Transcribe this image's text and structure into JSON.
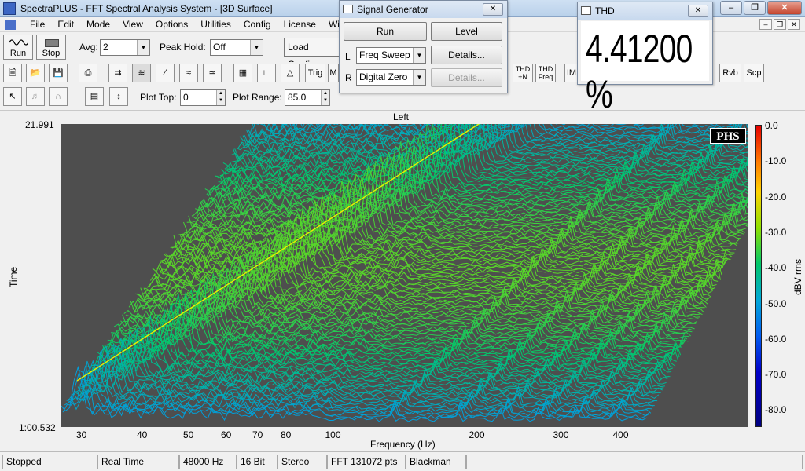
{
  "window": {
    "title": "SpectraPLUS - FFT Spectral Analysis System - [3D Surface]",
    "minimize_icon": "minimize-icon",
    "maximize_icon": "restore-icon",
    "close_icon": "close-icon"
  },
  "menu": {
    "items": [
      "File",
      "Edit",
      "Mode",
      "View",
      "Options",
      "Utilities",
      "Config",
      "License",
      "Window"
    ]
  },
  "toolbar": {
    "run_label": "Run",
    "stop_label": "Stop",
    "avg_label": "Avg:",
    "avg_value": "2",
    "peak_hold_label": "Peak Hold:",
    "peak_hold_value": "Off",
    "load_config_label": "Load Config",
    "trig_label": "Trig",
    "m_label": "M",
    "thd_n_label": "THD +N",
    "thd_freq_label": "THD Freq",
    "im_label": "IM",
    "rvb_label": "Rvb",
    "scp_label": "Scp",
    "plot_top_label": "Plot Top:",
    "plot_top_value": "0",
    "plot_range_label": "Plot Range:",
    "plot_range_value": "85.0"
  },
  "plot": {
    "channel_label": "Left",
    "y_top": "21.991",
    "y_bottom": "1:00.532",
    "y_label": "Time",
    "x_label": "Frequency (Hz)",
    "x_ticks": [
      "30",
      "40",
      "50",
      "60",
      "70",
      "80",
      "100",
      "200",
      "300",
      "400"
    ],
    "logo": "PHS",
    "colorbar_label": "dBV rms",
    "colorbar_ticks": [
      "0.0",
      "-10.0",
      "-20.0",
      "-30.0",
      "-40.0",
      "-50.0",
      "-60.0",
      "-70.0",
      "-80.0"
    ]
  },
  "status": {
    "state": "Stopped",
    "mode": "Real Time",
    "sample_rate": "48000 Hz",
    "bits": "16 Bit",
    "channels": "Stereo",
    "fft": "FFT 131072 pts",
    "window": "Blackman"
  },
  "signal_generator": {
    "title": "Signal Generator",
    "run_label": "Run",
    "level_label": "Level",
    "left_label": "L",
    "left_value": "Freq Sweep",
    "right_label": "R",
    "right_value": "Digital Zero",
    "details_label": "Details...",
    "details_disabled_label": "Details..."
  },
  "thd": {
    "title": "THD",
    "value": "4.41200 %"
  }
}
